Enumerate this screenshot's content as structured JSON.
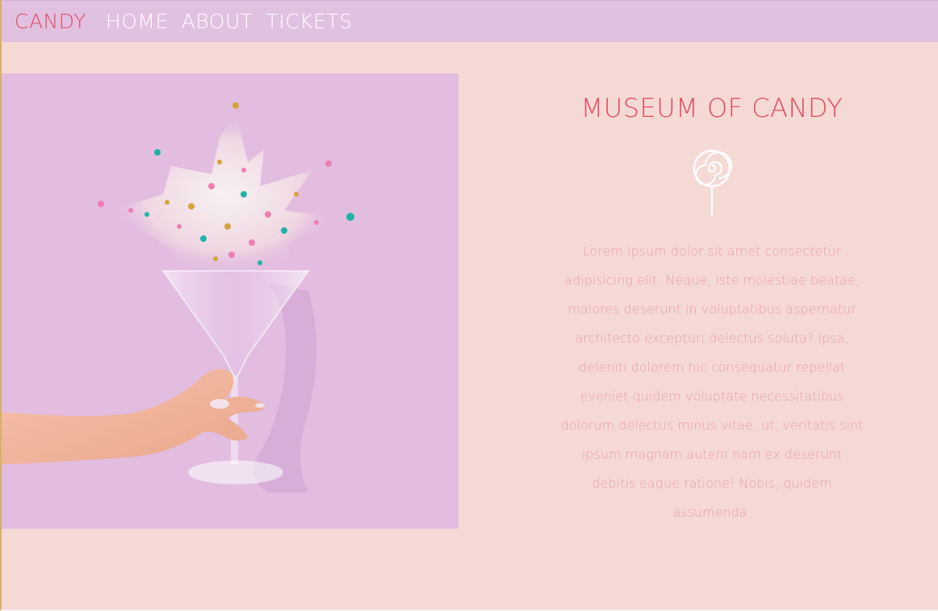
{
  "nav": {
    "brand": "CANDY",
    "links": [
      "HOME",
      "ABOUT",
      "TICKETS"
    ]
  },
  "main": {
    "title": "MUSEUM OF CANDY",
    "paragraph": "Lorem ipsum dolor sit amet consectetur adipisicing elit. Neque, iste molestiae beatae, maiores deserunt in voluptatibus aspernatur architecto excepturi delectus soluta? Ipsa, deleniti dolorem hic consequatur repellat eveniet quidem voluptate necessitatibus dolorum delectus minus vitae, ut, veritatis sint ipsum magnam autem nam ex deserunt debitis eaque ratione! Nobis, quidem assumenda.",
    "icon": "lollipop-icon",
    "hero_image": "hand holding martini glass with exploding sprinkles"
  },
  "colors": {
    "nav_bg": "#e1c1e0",
    "page_bg": "#f5d9d5",
    "accent": "#e24a5f",
    "text_pink": "#ec9eb0",
    "hero_bg": "#e2bde0"
  }
}
